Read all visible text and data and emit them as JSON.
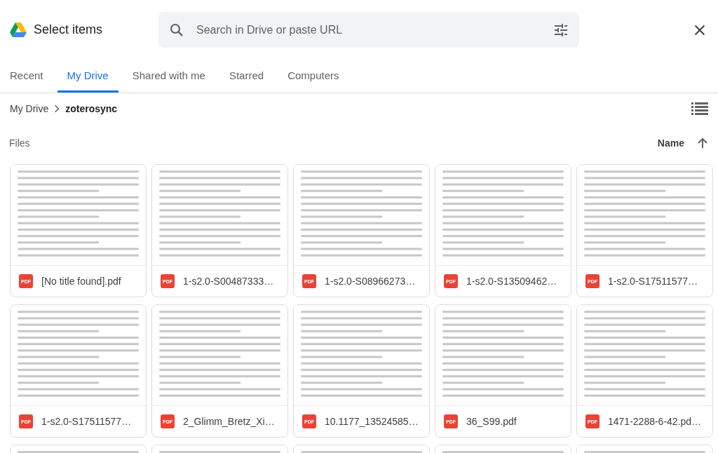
{
  "header": {
    "title": "Select items",
    "search": {
      "placeholder": "Search in Drive or paste URL"
    }
  },
  "tabs": [
    {
      "label": "Recent",
      "selected": false
    },
    {
      "label": "My Drive",
      "selected": true
    },
    {
      "label": "Shared with me",
      "selected": false
    },
    {
      "label": "Starred",
      "selected": false
    },
    {
      "label": "Computers",
      "selected": false
    }
  ],
  "breadcrumb": [
    {
      "label": "My Drive",
      "current": false
    },
    {
      "label": "zoterosync",
      "current": true
    }
  ],
  "section": {
    "label": "Files",
    "sort_label": "Name"
  },
  "files": [
    {
      "name": "[No title found].pdf",
      "type_label": "PDF"
    },
    {
      "name": "1-s2.0-S00487333…",
      "type_label": "PDF"
    },
    {
      "name": "1-s2.0-S08966273…",
      "type_label": "PDF"
    },
    {
      "name": "1-s2.0-S13509462…",
      "type_label": "PDF"
    },
    {
      "name": "1-s2.0-S17511577…",
      "type_label": "PDF"
    },
    {
      "name": "1-s2.0-S17511577…",
      "type_label": "PDF"
    },
    {
      "name": "2_Glimm_Bretz_Xi…",
      "type_label": "PDF"
    },
    {
      "name": "10.1177_13524585…",
      "type_label": "PDF"
    },
    {
      "name": "36_S99.pdf",
      "type_label": "PDF"
    },
    {
      "name": "1471-2288-6-42.pd…",
      "type_label": "PDF"
    },
    {
      "kind": "document"
    },
    {
      "kind": "document"
    },
    {
      "kind": "document"
    },
    {
      "kind": "document"
    },
    {
      "kind": "document"
    }
  ]
}
